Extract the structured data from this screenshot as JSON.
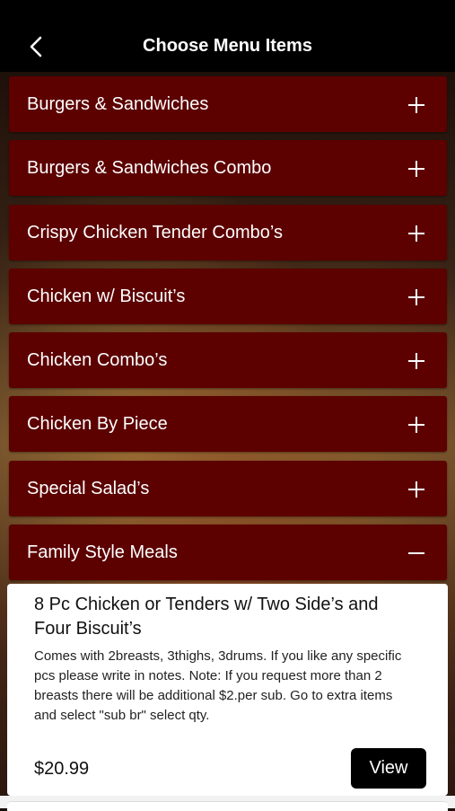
{
  "header": {
    "title": "Choose Menu Items",
    "back_icon": "chevron-left-icon"
  },
  "categories": [
    {
      "label": "Burgers & Sandwiches",
      "icon": "plus-icon",
      "expanded": false
    },
    {
      "label": "Burgers & Sandwiches Combo",
      "icon": "plus-icon",
      "expanded": false
    },
    {
      "label": "Crispy Chicken Tender Combo’s",
      "icon": "plus-icon",
      "expanded": false
    },
    {
      "label": "Chicken w/ Biscuit’s",
      "icon": "plus-icon",
      "expanded": false
    },
    {
      "label": "Chicken Combo’s",
      "icon": "plus-icon",
      "expanded": false
    },
    {
      "label": "Chicken By Piece",
      "icon": "plus-icon",
      "expanded": false
    },
    {
      "label": "Special Salad’s",
      "icon": "plus-icon",
      "expanded": false
    },
    {
      "label": "Family Style Meals",
      "icon": "minus-icon",
      "expanded": true
    }
  ],
  "item": {
    "name": "8 Pc Chicken or Tenders w/ Two Side’s and Four Biscuit’s",
    "description": "Comes with 2breasts, 3thighs, 3drums. If you like any specific pcs please write in notes. Note: If you request more than 2 breasts there will be additional $2.per sub. Go to extra items and select \"sub br\" select qty.",
    "price": "$20.99",
    "view_label": "View"
  },
  "colors": {
    "header_bg": "#000000",
    "category_bg": "#5c0000",
    "card_bg": "#ffffff",
    "button_bg": "#000000"
  }
}
